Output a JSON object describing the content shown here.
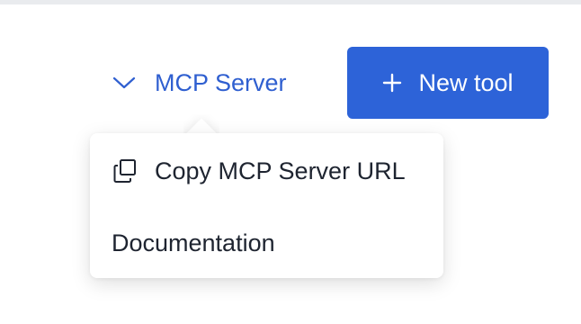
{
  "header": {
    "mcp_server_label": "MCP Server",
    "new_tool_label": "New tool"
  },
  "dropdown": {
    "items": [
      {
        "label": "Copy MCP Server URL",
        "icon": "copy-icon"
      },
      {
        "label": "Documentation"
      }
    ]
  },
  "colors": {
    "accent": "#2d63d8",
    "link": "#2f5fd0",
    "text": "#1e2430"
  }
}
